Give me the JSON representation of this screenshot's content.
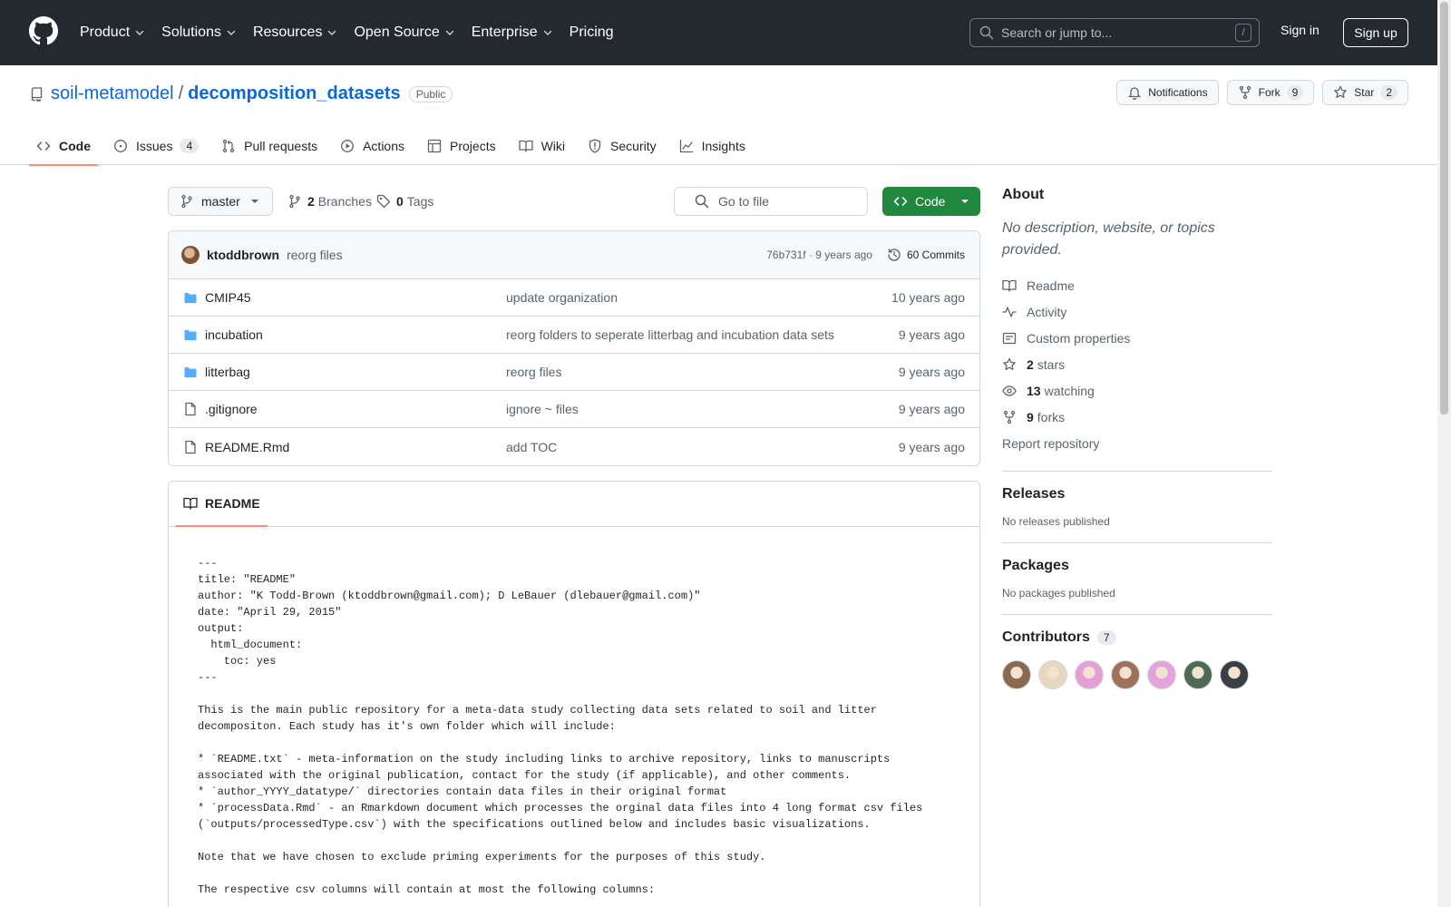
{
  "header": {
    "nav": [
      {
        "label": "Product",
        "dropdown": true
      },
      {
        "label": "Solutions",
        "dropdown": true
      },
      {
        "label": "Resources",
        "dropdown": true
      },
      {
        "label": "Open Source",
        "dropdown": true
      },
      {
        "label": "Enterprise",
        "dropdown": true
      },
      {
        "label": "Pricing",
        "dropdown": false
      }
    ],
    "search_placeholder": "Search or jump to...",
    "search_shortcut": "/",
    "signin": "Sign in",
    "signup": "Sign up"
  },
  "repo": {
    "owner": "soil-metamodel",
    "separator": "/",
    "name": "decomposition_datasets",
    "visibility": "Public",
    "notifications_label": "Notifications",
    "fork_label": "Fork",
    "fork_count": "9",
    "star_label": "Star",
    "star_count": "2",
    "tabs": [
      {
        "label": "Code",
        "icon": "code-icon",
        "active": true,
        "count": null
      },
      {
        "label": "Issues",
        "icon": "issue-icon",
        "active": false,
        "count": "4"
      },
      {
        "label": "Pull requests",
        "icon": "pull-request-icon",
        "active": false,
        "count": null
      },
      {
        "label": "Actions",
        "icon": "play-icon",
        "active": false,
        "count": null
      },
      {
        "label": "Projects",
        "icon": "table-icon",
        "active": false,
        "count": null
      },
      {
        "label": "Wiki",
        "icon": "book-icon",
        "active": false,
        "count": null
      },
      {
        "label": "Security",
        "icon": "shield-icon",
        "active": false,
        "count": null
      },
      {
        "label": "Insights",
        "icon": "graph-icon",
        "active": false,
        "count": null
      }
    ]
  },
  "toolbar": {
    "branch": "master",
    "branches_count": "2",
    "branches_label": "Branches",
    "tags_count": "0",
    "tags_label": "Tags",
    "goto_placeholder": "Go to file",
    "code_button": "Code"
  },
  "latest_commit": {
    "author": "ktoddbrown",
    "message": "reorg files",
    "sha_age": "76b731f · 9 years ago",
    "commits_label": "60 Commits"
  },
  "files": [
    {
      "type": "folder",
      "name": "CMIP45",
      "message": "update organization",
      "date": "10 years ago"
    },
    {
      "type": "folder",
      "name": "incubation",
      "message": "reorg folders to seperate litterbag and incubation data sets",
      "date": "9 years ago"
    },
    {
      "type": "folder",
      "name": "litterbag",
      "message": "reorg files",
      "date": "9 years ago"
    },
    {
      "type": "file",
      "name": ".gitignore",
      "message": "ignore ~ files",
      "date": "9 years ago"
    },
    {
      "type": "file",
      "name": "README.Rmd",
      "message": "add TOC",
      "date": "9 years ago"
    }
  ],
  "readme": {
    "tab_label": "README",
    "content": "---\ntitle: \"README\"\nauthor: \"K Todd-Brown (ktoddbrown@gmail.com); D LeBauer (dlebauer@gmail.com)\"\ndate: \"April 29, 2015\"\noutput:\n  html_document:\n    toc: yes\n---\n\nThis is the main public repository for a meta-data study collecting data sets related to soil and litter\ndecompositon. Each study has it's own folder which will include:\n\n* `README.txt` - meta-information on the study including links to archive repository, links to manuscripts\nassociated with the original publication, contact for the study (if applicable), and other comments.\n* `author_YYYY_datatype/` directories contain data files in their original format\n* `processData.Rmd` - an Rmarkdown document which processes the orginal data files into 4 long format csv files\n(`outputs/processedType.csv`) with the specifications outlined below and includes basic visualizations.\n\nNote that we have chosen to exclude priming experiments for the purposes of this study.\n\nThe respective csv columns will contain at most the following columns:"
  },
  "sidebar": {
    "about_title": "About",
    "about_desc": "No description, website, or topics provided.",
    "links": [
      {
        "icon": "book-icon",
        "count": "",
        "label": "Readme"
      },
      {
        "icon": "pulse-icon",
        "count": "",
        "label": "Activity"
      },
      {
        "icon": "note-icon",
        "count": "",
        "label": "Custom properties"
      },
      {
        "icon": "star-icon",
        "count": "2",
        "label": "stars"
      },
      {
        "icon": "eye-icon",
        "count": "13",
        "label": "watching"
      },
      {
        "icon": "fork-icon",
        "count": "9",
        "label": "forks"
      }
    ],
    "report": "Report repository",
    "releases_title": "Releases",
    "releases_empty": "No releases published",
    "packages_title": "Packages",
    "packages_empty": "No packages published",
    "contributors_title": "Contributors",
    "contributors_count": "7",
    "contributor_colors": [
      "#8a6a4f",
      "#e8d6c0",
      "#e59fd6",
      "#a0705a",
      "#e5a3dc",
      "#4d6a55",
      "#3a3f44"
    ]
  },
  "colors": {
    "header_bg": "#24292f",
    "link": "#0969da",
    "primary_green": "#1f883d",
    "active_tab_underline": "#fd8c73",
    "folder": "#54aeff"
  }
}
